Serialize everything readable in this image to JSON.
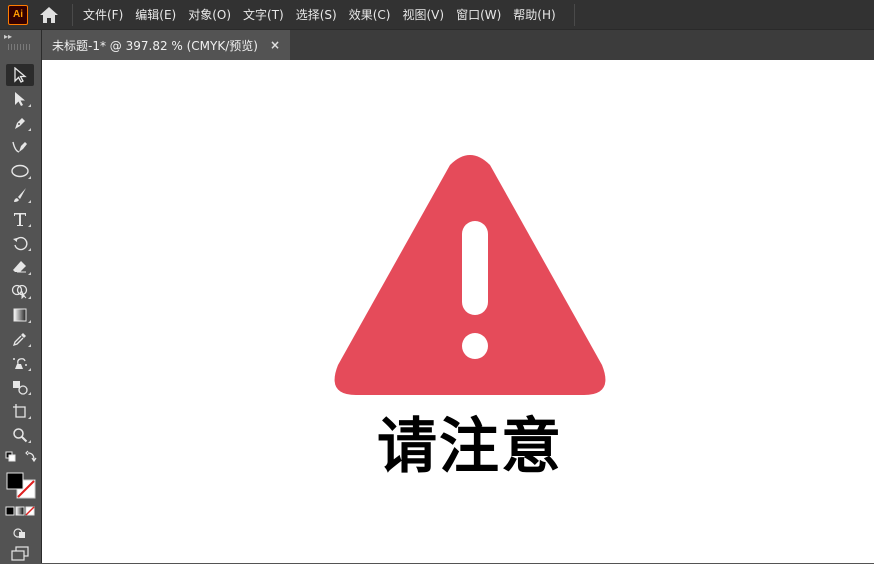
{
  "app": {
    "logo_text": "Ai",
    "brand_color": "#ff9a00"
  },
  "menu": {
    "items": [
      "文件(F)",
      "编辑(E)",
      "对象(O)",
      "文字(T)",
      "选择(S)",
      "效果(C)",
      "视图(V)",
      "窗口(W)",
      "帮助(H)"
    ]
  },
  "document": {
    "tab_label": "未标题-1* @ 397.82 % (CMYK/预览)",
    "close_glyph": "×"
  },
  "toolbar": {
    "collapse_glyph": "▸▸",
    "tools": [
      "selection-tool",
      "direct-selection-tool",
      "pen-tool",
      "curvature-tool",
      "ellipse-tool",
      "paintbrush-tool",
      "type-tool",
      "rotate-tool",
      "eraser-tool",
      "shape-builder-tool",
      "gradient-tool",
      "eyedropper-tool",
      "symbol-sprayer-tool",
      "blend-tool",
      "artboard-tool",
      "zoom-tool"
    ]
  },
  "artwork": {
    "warning_color": "#e54b5a",
    "caption": "请注意"
  }
}
